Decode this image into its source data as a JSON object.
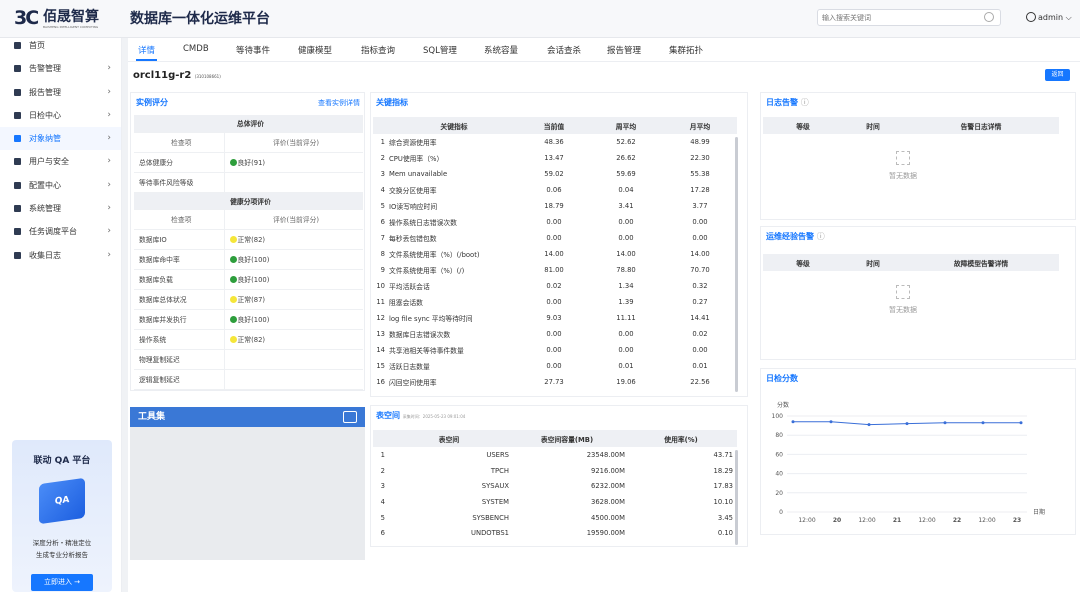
{
  "header": {
    "logo_mark": "3C",
    "logo_text": "佰晟智算",
    "logo_sub": "BAISHENG INTELLIGENT COMPUTING",
    "title": "数据库一体化运维平台",
    "search_placeholder": "输入搜索关键词",
    "user": "admin"
  },
  "sidebar": {
    "items": [
      {
        "label": "首页",
        "icon": "home-icon",
        "chevron": false
      },
      {
        "label": "告警管理",
        "icon": "alarm-icon",
        "chevron": true
      },
      {
        "label": "报告管理",
        "icon": "report-icon",
        "chevron": true
      },
      {
        "label": "日检中心",
        "icon": "check-icon",
        "chevron": true
      },
      {
        "label": "对象纳管",
        "icon": "monitor-icon",
        "chevron": true
      },
      {
        "label": "用户与安全",
        "icon": "user-security-icon",
        "chevron": true
      },
      {
        "label": "配置中心",
        "icon": "config-icon",
        "chevron": true
      },
      {
        "label": "系统管理",
        "icon": "system-icon",
        "chevron": true
      },
      {
        "label": "任务调度平台",
        "icon": "task-icon",
        "chevron": true
      },
      {
        "label": "收集日志",
        "icon": "log-icon",
        "chevron": true
      }
    ],
    "active": 4,
    "promo": {
      "title": "联动 QA 平台",
      "art": "QA",
      "line1": "深度分析・精准定位",
      "line2": "生成专业分析报告",
      "button": "立即进入 →"
    }
  },
  "tabs": [
    "详情",
    "CMDB",
    "等待事件",
    "健康模型",
    "指标查询",
    "SQL管理",
    "系统容量",
    "会话查杀",
    "报告管理",
    "集群拓扑"
  ],
  "instance": {
    "name": "orcl11g-r2",
    "id": "(310108661)",
    "back": "返回"
  },
  "eval": {
    "title": "实例评分",
    "link": "查看实例详情",
    "overall_title": "总体评价",
    "col1": "检查项",
    "col2": "评价(当前评分)",
    "overall": [
      {
        "item": "总体健康分",
        "status": "良好(91)",
        "color": "#2e9e3c"
      },
      {
        "item": "等待事件风险等级",
        "status": "",
        "color": ""
      }
    ],
    "health_title": "健康分项评价",
    "health": [
      {
        "item": "数据库IO",
        "status": "正常(82)",
        "color": "#f5e63a"
      },
      {
        "item": "数据库命中率",
        "status": "良好(100)",
        "color": "#2e9e3c"
      },
      {
        "item": "数据库负载",
        "status": "良好(100)",
        "color": "#2e9e3c"
      },
      {
        "item": "数据库总体状况",
        "status": "正常(87)",
        "color": "#f5e63a"
      },
      {
        "item": "数据库并发执行",
        "status": "良好(100)",
        "color": "#2e9e3c"
      },
      {
        "item": "操作系统",
        "status": "正常(82)",
        "color": "#f5e63a"
      },
      {
        "item": "物理复制延迟",
        "status": "",
        "color": ""
      },
      {
        "item": "逻辑复制延迟",
        "status": "",
        "color": ""
      }
    ]
  },
  "tools": {
    "title": "工具集"
  },
  "metrics": {
    "title": "关键指标",
    "headers": [
      "关键指标",
      "当前值",
      "周平均",
      "月平均"
    ],
    "rows": [
      [
        "1",
        "综合资源使用率",
        "48.36",
        "52.62",
        "48.99"
      ],
      [
        "2",
        "CPU使用率（%）",
        "13.47",
        "26.62",
        "22.30"
      ],
      [
        "3",
        "Mem unavailable",
        "59.02",
        "59.69",
        "55.38"
      ],
      [
        "4",
        "交换分区使用率",
        "0.06",
        "0.04",
        "17.28"
      ],
      [
        "5",
        "IO读写响应时间",
        "18.79",
        "3.41",
        "3.77"
      ],
      [
        "6",
        "操作系统日志错误次数",
        "0.00",
        "0.00",
        "0.00"
      ],
      [
        "7",
        "每秒丢包错包数",
        "0.00",
        "0.00",
        "0.00"
      ],
      [
        "8",
        "文件系统使用率（%）(/boot)",
        "14.00",
        "14.00",
        "14.00"
      ],
      [
        "9",
        "文件系统使用率（%）(/)",
        "81.00",
        "78.80",
        "70.70"
      ],
      [
        "10",
        "平均活跃会话",
        "0.02",
        "1.34",
        "0.32"
      ],
      [
        "11",
        "阻塞会话数",
        "0.00",
        "1.39",
        "0.27"
      ],
      [
        "12",
        "log file sync 平均等待时间",
        "9.03",
        "11.11",
        "14.41"
      ],
      [
        "13",
        "数据库日志错误次数",
        "0.00",
        "0.00",
        "0.02"
      ],
      [
        "14",
        "共享池相关等待事件数量",
        "0.00",
        "0.00",
        "0.00"
      ],
      [
        "15",
        "活跃日志数量",
        "0.00",
        "0.01",
        "0.01"
      ],
      [
        "16",
        "闪回空间使用率",
        "27.73",
        "19.06",
        "22.56"
      ]
    ]
  },
  "tablespace": {
    "title": "表空间",
    "time": "采集时间：2025-05-23 09:01:04",
    "headers": [
      "表空间",
      "表空间容量(MB)",
      "使用率(%)"
    ],
    "rows": [
      [
        "1",
        "USERS",
        "23548.00M",
        "43.71"
      ],
      [
        "2",
        "TPCH",
        "9216.00M",
        "18.29"
      ],
      [
        "3",
        "SYSAUX",
        "6232.00M",
        "17.83"
      ],
      [
        "4",
        "SYSTEM",
        "3628.00M",
        "10.10"
      ],
      [
        "5",
        "SYSBENCH",
        "4500.00M",
        "3.45"
      ],
      [
        "6",
        "UNDOTBS1",
        "19590.00M",
        "0.10"
      ]
    ]
  },
  "log_alert": {
    "title": "日志告警",
    "headers": [
      "等级",
      "时间",
      "告警日志详情"
    ],
    "empty": "暂无数据"
  },
  "ops_alert": {
    "title": "运维经验告警",
    "headers": [
      "等级",
      "时间",
      "故障模型告警详情"
    ],
    "empty": "暂无数据"
  },
  "chart_data": {
    "type": "line",
    "title": "日检分数",
    "ylabel": "分数",
    "xlabel": "日期",
    "ylim": [
      0,
      100
    ],
    "yticks": [
      0,
      20,
      40,
      60,
      80,
      100
    ],
    "xticks": [
      "12:00",
      "20",
      "12:00",
      "21",
      "12:00",
      "22",
      "12:00",
      "23"
    ],
    "series": [
      {
        "values": [
          {
            "x": "05-19 12:00",
            "y": 94
          },
          {
            "x": "20",
            "y": 94
          },
          {
            "x": "05-20 12:00",
            "y": 91
          },
          {
            "x": "21",
            "y": 92
          },
          {
            "x": "05-21 12:00",
            "y": 93
          },
          {
            "x": "22",
            "y": 93
          },
          {
            "x": "05-22 12:00",
            "y": 93
          }
        ]
      }
    ],
    "color": "#3a6fd8"
  }
}
